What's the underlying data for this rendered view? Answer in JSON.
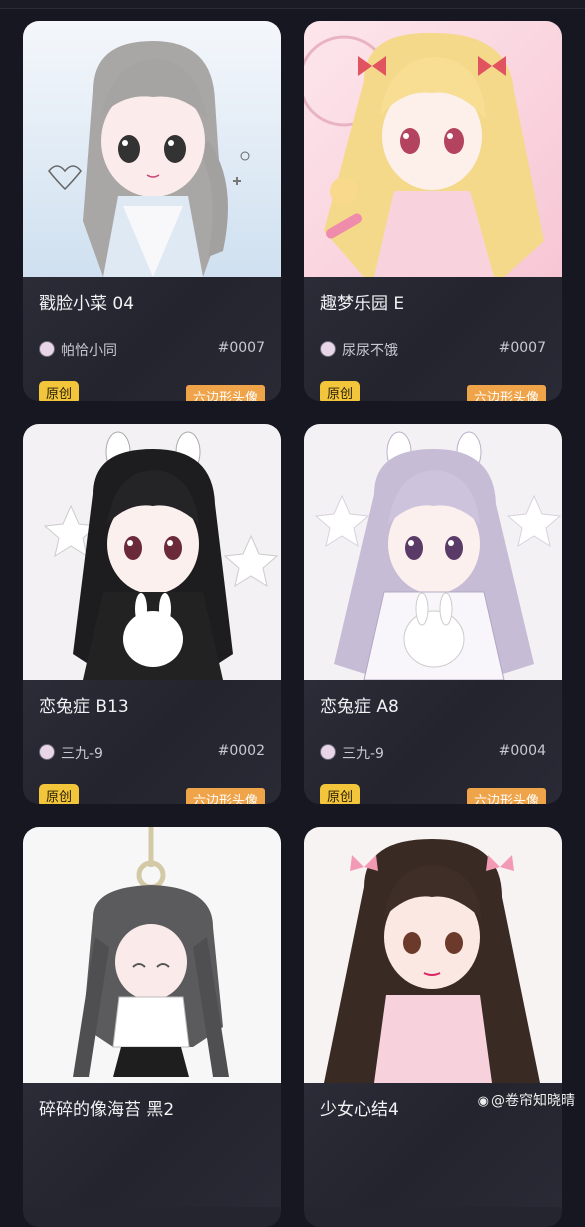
{
  "cards": [
    {
      "title": "戳脸小菜 04",
      "author": "帕恰小同",
      "number": "#0007",
      "badge": "原创",
      "tag": "六边形头像",
      "image": "gray-haired girl, pastel blue background"
    },
    {
      "title": "趣梦乐园 E",
      "author": "尿尿不饿",
      "number": "#0007",
      "badge": "原创",
      "tag": "六边形头像",
      "image": "blonde girl with bows, amusement park background"
    },
    {
      "title": "恋兔症 B13",
      "author": "三九-9",
      "number": "#0002",
      "badge": "原创",
      "tag": "六边形头像",
      "image": "black-haired girl with bunny ears holding rabbit"
    },
    {
      "title": "恋兔症 A8",
      "author": "三九-9",
      "number": "#0004",
      "badge": "原创",
      "tag": "六边形头像",
      "image": "lavender-haired girl with bunny ears holding rabbit"
    },
    {
      "title": "碎碎的像海苔 黑2",
      "image": "chibi gray-haired girl hanging from rope"
    },
    {
      "title": "少女心结4",
      "image": "brown-haired girl with pink bows"
    }
  ],
  "watermark": "@卷帘知晓晴",
  "colors": {
    "background": "#171722",
    "card": "#25252f",
    "badge": "#f3c53a",
    "tag": "#f0a44a"
  }
}
